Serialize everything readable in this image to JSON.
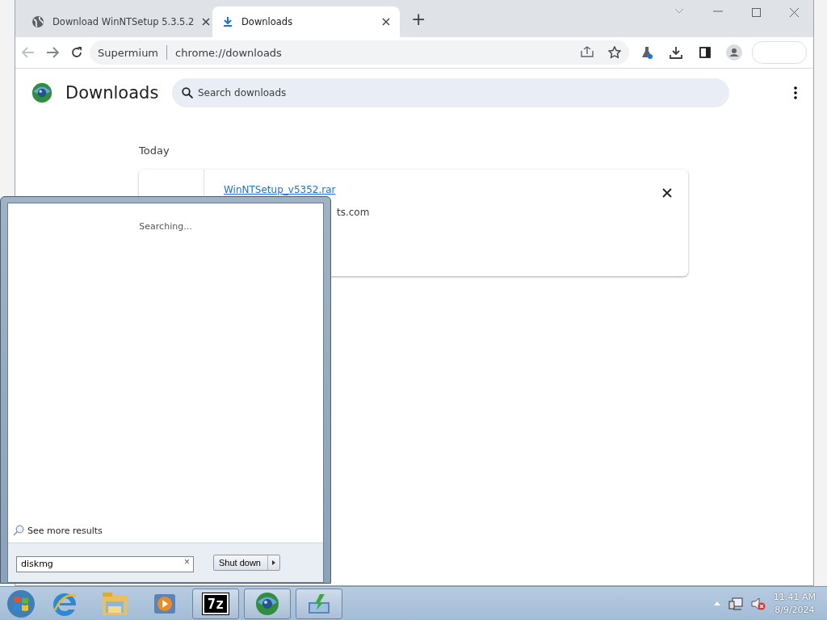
{
  "browser": {
    "tabs": [
      {
        "title": "Download WinNTSetup 5.3.5.2",
        "selected": false
      },
      {
        "title": "Downloads",
        "selected": true
      }
    ],
    "new_tab": "+",
    "address": {
      "site": "Supermium",
      "url": "chrome://downloads"
    },
    "page": {
      "title": "Downloads",
      "search_placeholder": "Search downloads",
      "section": "Today",
      "downloads": [
        {
          "file": "WinNTSetup_v5352.rar",
          "source": "ts.com"
        }
      ]
    }
  },
  "start_menu": {
    "status": "Searching...",
    "see_more": "See more results",
    "search_value": "diskmg",
    "clear": "×",
    "shutdown": "Shut down"
  },
  "taskbar": {
    "apps": [
      {
        "kind": "ie",
        "running": false
      },
      {
        "kind": "explorer",
        "running": false
      },
      {
        "kind": "media",
        "running": false
      },
      {
        "kind": "sevenzip",
        "label": "7z",
        "running": true
      },
      {
        "kind": "orb",
        "running": true
      },
      {
        "kind": "installer",
        "running": true
      }
    ],
    "clock": {
      "time": "11:41 AM",
      "date": "8/9/2024"
    }
  }
}
